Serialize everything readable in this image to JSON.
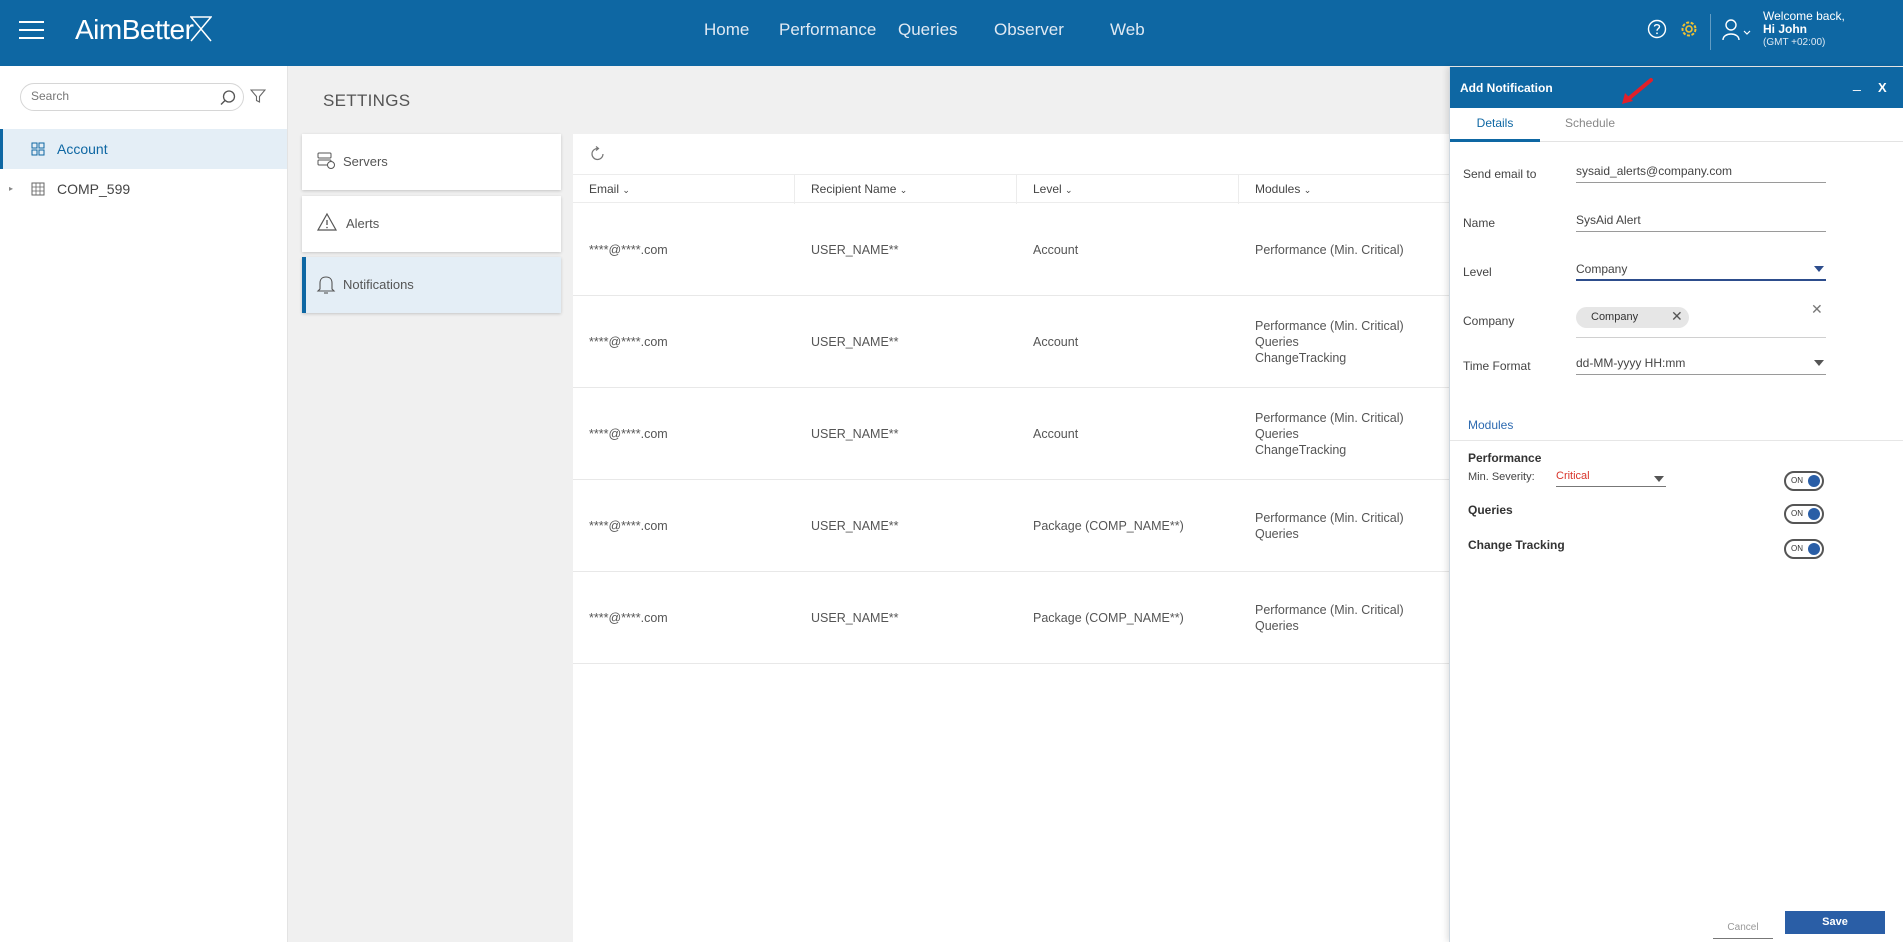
{
  "header": {
    "app_name": "AimBetter",
    "nav": [
      "Home",
      "Performance",
      "Queries",
      "Observer",
      "Web"
    ],
    "welcome": "Welcome back,",
    "user": "Hi John",
    "timezone": "(GMT +02:00)"
  },
  "sidebar": {
    "search_placeholder": "Search",
    "items": [
      {
        "label": "Account"
      },
      {
        "label": "COMP_599"
      }
    ]
  },
  "settings": {
    "title": "SETTINGS",
    "menu": [
      {
        "label": "Servers"
      },
      {
        "label": "Alerts"
      },
      {
        "label": "Notifications"
      }
    ]
  },
  "table": {
    "columns": [
      "Email",
      "Recipient Name",
      "Level",
      "Modules"
    ],
    "rows": [
      {
        "email": "****@****.com",
        "name": "USER_NAME**",
        "level": "Account",
        "modules": [
          "Performance (Min. Critical)"
        ]
      },
      {
        "email": "****@****.com",
        "name": "USER_NAME**",
        "level": "Account",
        "modules": [
          "Performance (Min. Critical)",
          "Queries",
          "ChangeTracking"
        ]
      },
      {
        "email": "****@****.com",
        "name": "USER_NAME**",
        "level": "Account",
        "modules": [
          "Performance (Min. Critical)",
          "Queries",
          "ChangeTracking"
        ]
      },
      {
        "email": "****@****.com",
        "name": "USER_NAME**",
        "level": "Package (COMP_NAME**)",
        "modules": [
          "Performance (Min. Critical)",
          "Queries"
        ]
      },
      {
        "email": "****@****.com",
        "name": "USER_NAME**",
        "level": "Package (COMP_NAME**)",
        "modules": [
          "Performance (Min. Critical)",
          "Queries"
        ]
      }
    ]
  },
  "dialog": {
    "title": "Add Notification",
    "minimize": "_",
    "close": "X",
    "tabs": [
      "Details",
      "Schedule"
    ],
    "fields": {
      "send_email_label": "Send email to",
      "send_email_value": "sysaid_alerts@company.com",
      "name_label": "Name",
      "name_value": "SysAid Alert",
      "level_label": "Level",
      "level_value": "Company",
      "company_label": "Company",
      "company_chip": "Company",
      "time_format_label": "Time Format",
      "time_format_value": "dd-MM-yyyy HH:mm"
    },
    "modules": {
      "title": "Modules",
      "performance": "Performance",
      "min_severity_label": "Min. Severity:",
      "min_severity_value": "Critical",
      "queries": "Queries",
      "change_tracking": "Change Tracking",
      "toggle_label": "ON"
    },
    "cancel": "Cancel",
    "save": "Save"
  },
  "colors": {
    "brand": "#0e67a3",
    "button": "#2a5ea6",
    "severity": "#d9342b",
    "annotation_arrow": "#e0202a"
  }
}
